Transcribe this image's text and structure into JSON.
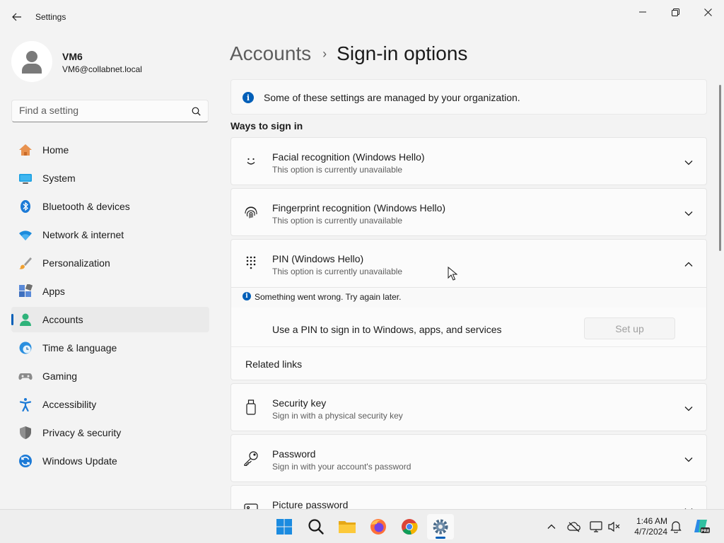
{
  "window": {
    "title": "Settings"
  },
  "profile": {
    "name": "VM6",
    "email": "VM6@collabnet.local"
  },
  "search": {
    "placeholder": "Find a setting"
  },
  "nav": {
    "items": [
      {
        "label": "Home",
        "icon": "home-icon",
        "selected": false
      },
      {
        "label": "System",
        "icon": "system-icon",
        "selected": false
      },
      {
        "label": "Bluetooth & devices",
        "icon": "bluetooth-icon",
        "selected": false
      },
      {
        "label": "Network & internet",
        "icon": "wifi-icon",
        "selected": false
      },
      {
        "label": "Personalization",
        "icon": "brush-icon",
        "selected": false
      },
      {
        "label": "Apps",
        "icon": "apps-icon",
        "selected": false
      },
      {
        "label": "Accounts",
        "icon": "person-icon",
        "selected": true
      },
      {
        "label": "Time & language",
        "icon": "globe-clock-icon",
        "selected": false
      },
      {
        "label": "Gaming",
        "icon": "gamepad-icon",
        "selected": false
      },
      {
        "label": "Accessibility",
        "icon": "accessibility-icon",
        "selected": false
      },
      {
        "label": "Privacy & security",
        "icon": "shield-icon",
        "selected": false
      },
      {
        "label": "Windows Update",
        "icon": "update-icon",
        "selected": false
      }
    ]
  },
  "breadcrumb": {
    "parent": "Accounts",
    "separator": "›",
    "current": "Sign-in options"
  },
  "banner": {
    "text": "Some of these settings are managed by your organization."
  },
  "section": {
    "title": "Ways to sign in"
  },
  "cards": {
    "facial": {
      "title": "Facial recognition (Windows Hello)",
      "subtitle": "This option is currently unavailable"
    },
    "fingerprint": {
      "title": "Fingerprint recognition (Windows Hello)",
      "subtitle": "This option is currently unavailable"
    },
    "pin": {
      "title": "PIN (Windows Hello)",
      "subtitle": "This option is currently unavailable"
    },
    "security_key": {
      "title": "Security key",
      "subtitle": "Sign in with a physical security key"
    },
    "password": {
      "title": "Password",
      "subtitle": "Sign in with your account's password"
    },
    "picture_password": {
      "title": "Picture password"
    }
  },
  "pin_expanded": {
    "error": "Something went wrong. Try again later.",
    "row_label": "Use a PIN to sign in to Windows, apps, and services",
    "button": "Set up",
    "related": "Related links"
  },
  "taskbar": {
    "time": "1:46 AM",
    "date": "4/7/2024",
    "apps": [
      "start-icon",
      "search-icon",
      "file-explorer-icon",
      "firefox-icon",
      "chrome-icon",
      "settings-icon"
    ],
    "active_app": "settings-icon"
  },
  "colors": {
    "accent": "#005fb8",
    "background": "#f3f3f3",
    "card": "#fbfbfb"
  }
}
